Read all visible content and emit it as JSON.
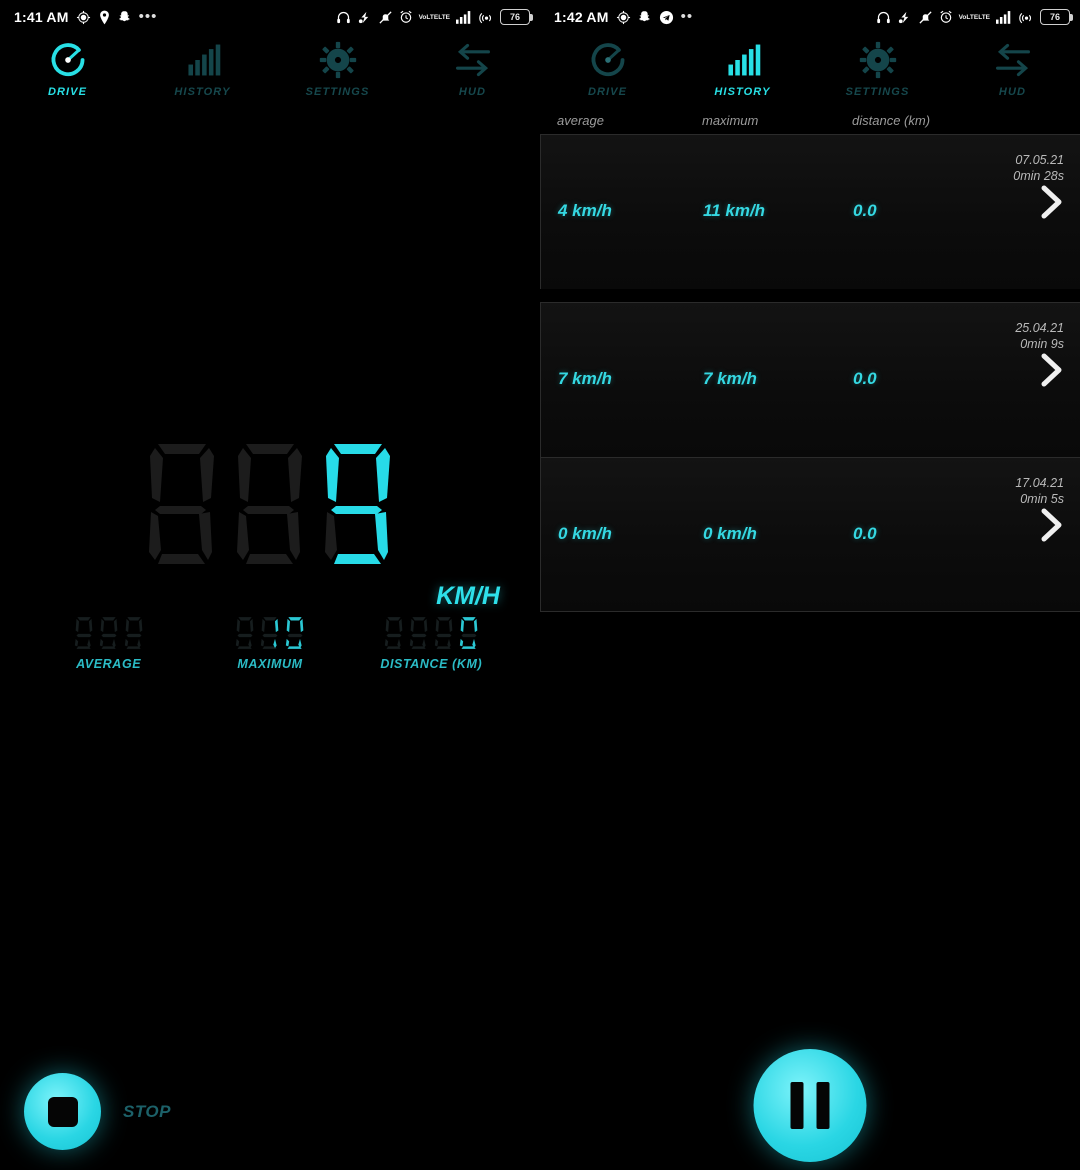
{
  "app": {
    "accent": "#28e0e6",
    "dim_accent": "#16484d",
    "background": "#000000"
  },
  "left_screen": {
    "status_bar": {
      "time": "1:41 AM",
      "left_icons": [
        "location-crosshair-icon",
        "location-pin-icon",
        "snapchat-icon",
        "overflow-dots-icon"
      ],
      "right_icons": [
        "headphones-icon",
        "vibrate-icon",
        "bell-muted-icon",
        "alarm-icon",
        "volte-icon",
        "signal-bars-icon",
        "hotspot-icon"
      ],
      "volte_label_top": "VoLTE",
      "volte_label_bottom": "LTE",
      "battery_level": "76"
    },
    "nav": [
      {
        "label": "DRIVE",
        "icon": "speedometer-icon",
        "active": true
      },
      {
        "label": "HISTORY",
        "icon": "bar-chart-icon",
        "active": false
      },
      {
        "label": "SETTINGS",
        "icon": "gear-icon",
        "active": false
      },
      {
        "label": "HUD",
        "icon": "arrows-flip-icon",
        "active": false
      }
    ],
    "speedometer": {
      "digits": [
        "",
        "",
        "9"
      ],
      "unit": "KM/H"
    },
    "stats": [
      {
        "label": "AVERAGE",
        "digits": [
          "",
          "",
          ""
        ]
      },
      {
        "label": "MAXIMUM",
        "digits": [
          "",
          "1",
          "0"
        ]
      },
      {
        "label": "DISTANCE (KM)",
        "digits": [
          "",
          "",
          "",
          "0"
        ]
      }
    ],
    "controls": {
      "stop_label": "STOP",
      "stop_icon": "stop-square-icon",
      "pause_icon": "pause-icon"
    }
  },
  "right_screen": {
    "status_bar": {
      "time": "1:42 AM",
      "left_icons": [
        "location-crosshair-icon",
        "snapchat-icon",
        "telegram-icon",
        "overflow-dots-icon"
      ],
      "right_icons": [
        "headphones-icon",
        "vibrate-icon",
        "bell-muted-icon",
        "alarm-icon",
        "volte-icon",
        "signal-bars-icon",
        "hotspot-icon"
      ],
      "volte_label_top": "VoLTE",
      "volte_label_bottom": "LTE",
      "battery_level": "76"
    },
    "nav": [
      {
        "label": "DRIVE",
        "icon": "speedometer-icon",
        "active": false
      },
      {
        "label": "HISTORY",
        "icon": "bar-chart-icon",
        "active": true
      },
      {
        "label": "SETTINGS",
        "icon": "gear-icon",
        "active": false
      },
      {
        "label": "HUD",
        "icon": "arrows-flip-icon",
        "active": false
      }
    ],
    "history": {
      "columns": [
        "average",
        "maximum",
        "distance (km)"
      ],
      "rows": [
        {
          "date": "07.05.21",
          "duration": "0min 28s",
          "average": "4 km/h",
          "maximum": "11 km/h",
          "distance": "0.0",
          "chevron": "chevron-right-icon"
        },
        {
          "date": "25.04.21",
          "duration": "0min 9s",
          "average": "7 km/h",
          "maximum": "7 km/h",
          "distance": "0.0",
          "chevron": "chevron-right-icon"
        },
        {
          "date": "17.04.21",
          "duration": "0min 5s",
          "average": "0 km/h",
          "maximum": "0 km/h",
          "distance": "0.0",
          "chevron": "chevron-right-icon"
        }
      ]
    }
  }
}
